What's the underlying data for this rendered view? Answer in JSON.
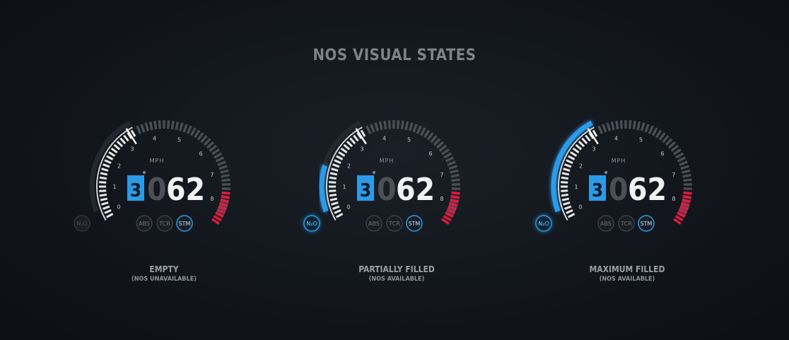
{
  "title": "NOS VISUAL STATES",
  "colors": {
    "accent_blue": "#2b9be8",
    "redline": "#e5193f",
    "tick_white": "#e8e8e8",
    "track_grey": "#4a4e55"
  },
  "gauges": [
    {
      "state": "EMPTY",
      "state_note": "(NOS UNAVAILABLE)",
      "nos_fill": 0,
      "nos_active": false,
      "nos_label": "N₂O",
      "gear": "3",
      "speed_dim": "0",
      "speed": "62",
      "unit": "MPH",
      "scale": [
        "0",
        "1",
        "2",
        "3",
        "4",
        "5",
        "6",
        "7",
        "8"
      ],
      "buttons": [
        "ABS",
        "TCR",
        "STM"
      ],
      "active_button": "STM"
    },
    {
      "state": "PARTIALLY FILLED",
      "state_note": "(NOS AVAILABLE)",
      "nos_fill": 0.45,
      "nos_active": true,
      "nos_label": "N₂O",
      "gear": "3",
      "speed_dim": "0",
      "speed": "62",
      "unit": "MPH",
      "scale": [
        "0",
        "1",
        "2",
        "3",
        "4",
        "5",
        "6",
        "7",
        "8"
      ],
      "buttons": [
        "ABS",
        "TCR",
        "STM"
      ],
      "active_button": "STM"
    },
    {
      "state": "MAXIMUM FILLED",
      "state_note": "(NOS AVAILABLE)",
      "nos_fill": 1,
      "nos_active": true,
      "nos_label": "N₂O",
      "gear": "3",
      "speed_dim": "0",
      "speed": "62",
      "unit": "MPH",
      "scale": [
        "0",
        "1",
        "2",
        "3",
        "4",
        "5",
        "6",
        "7",
        "8"
      ],
      "buttons": [
        "ABS",
        "TCR",
        "STM"
      ],
      "active_button": "STM"
    }
  ]
}
